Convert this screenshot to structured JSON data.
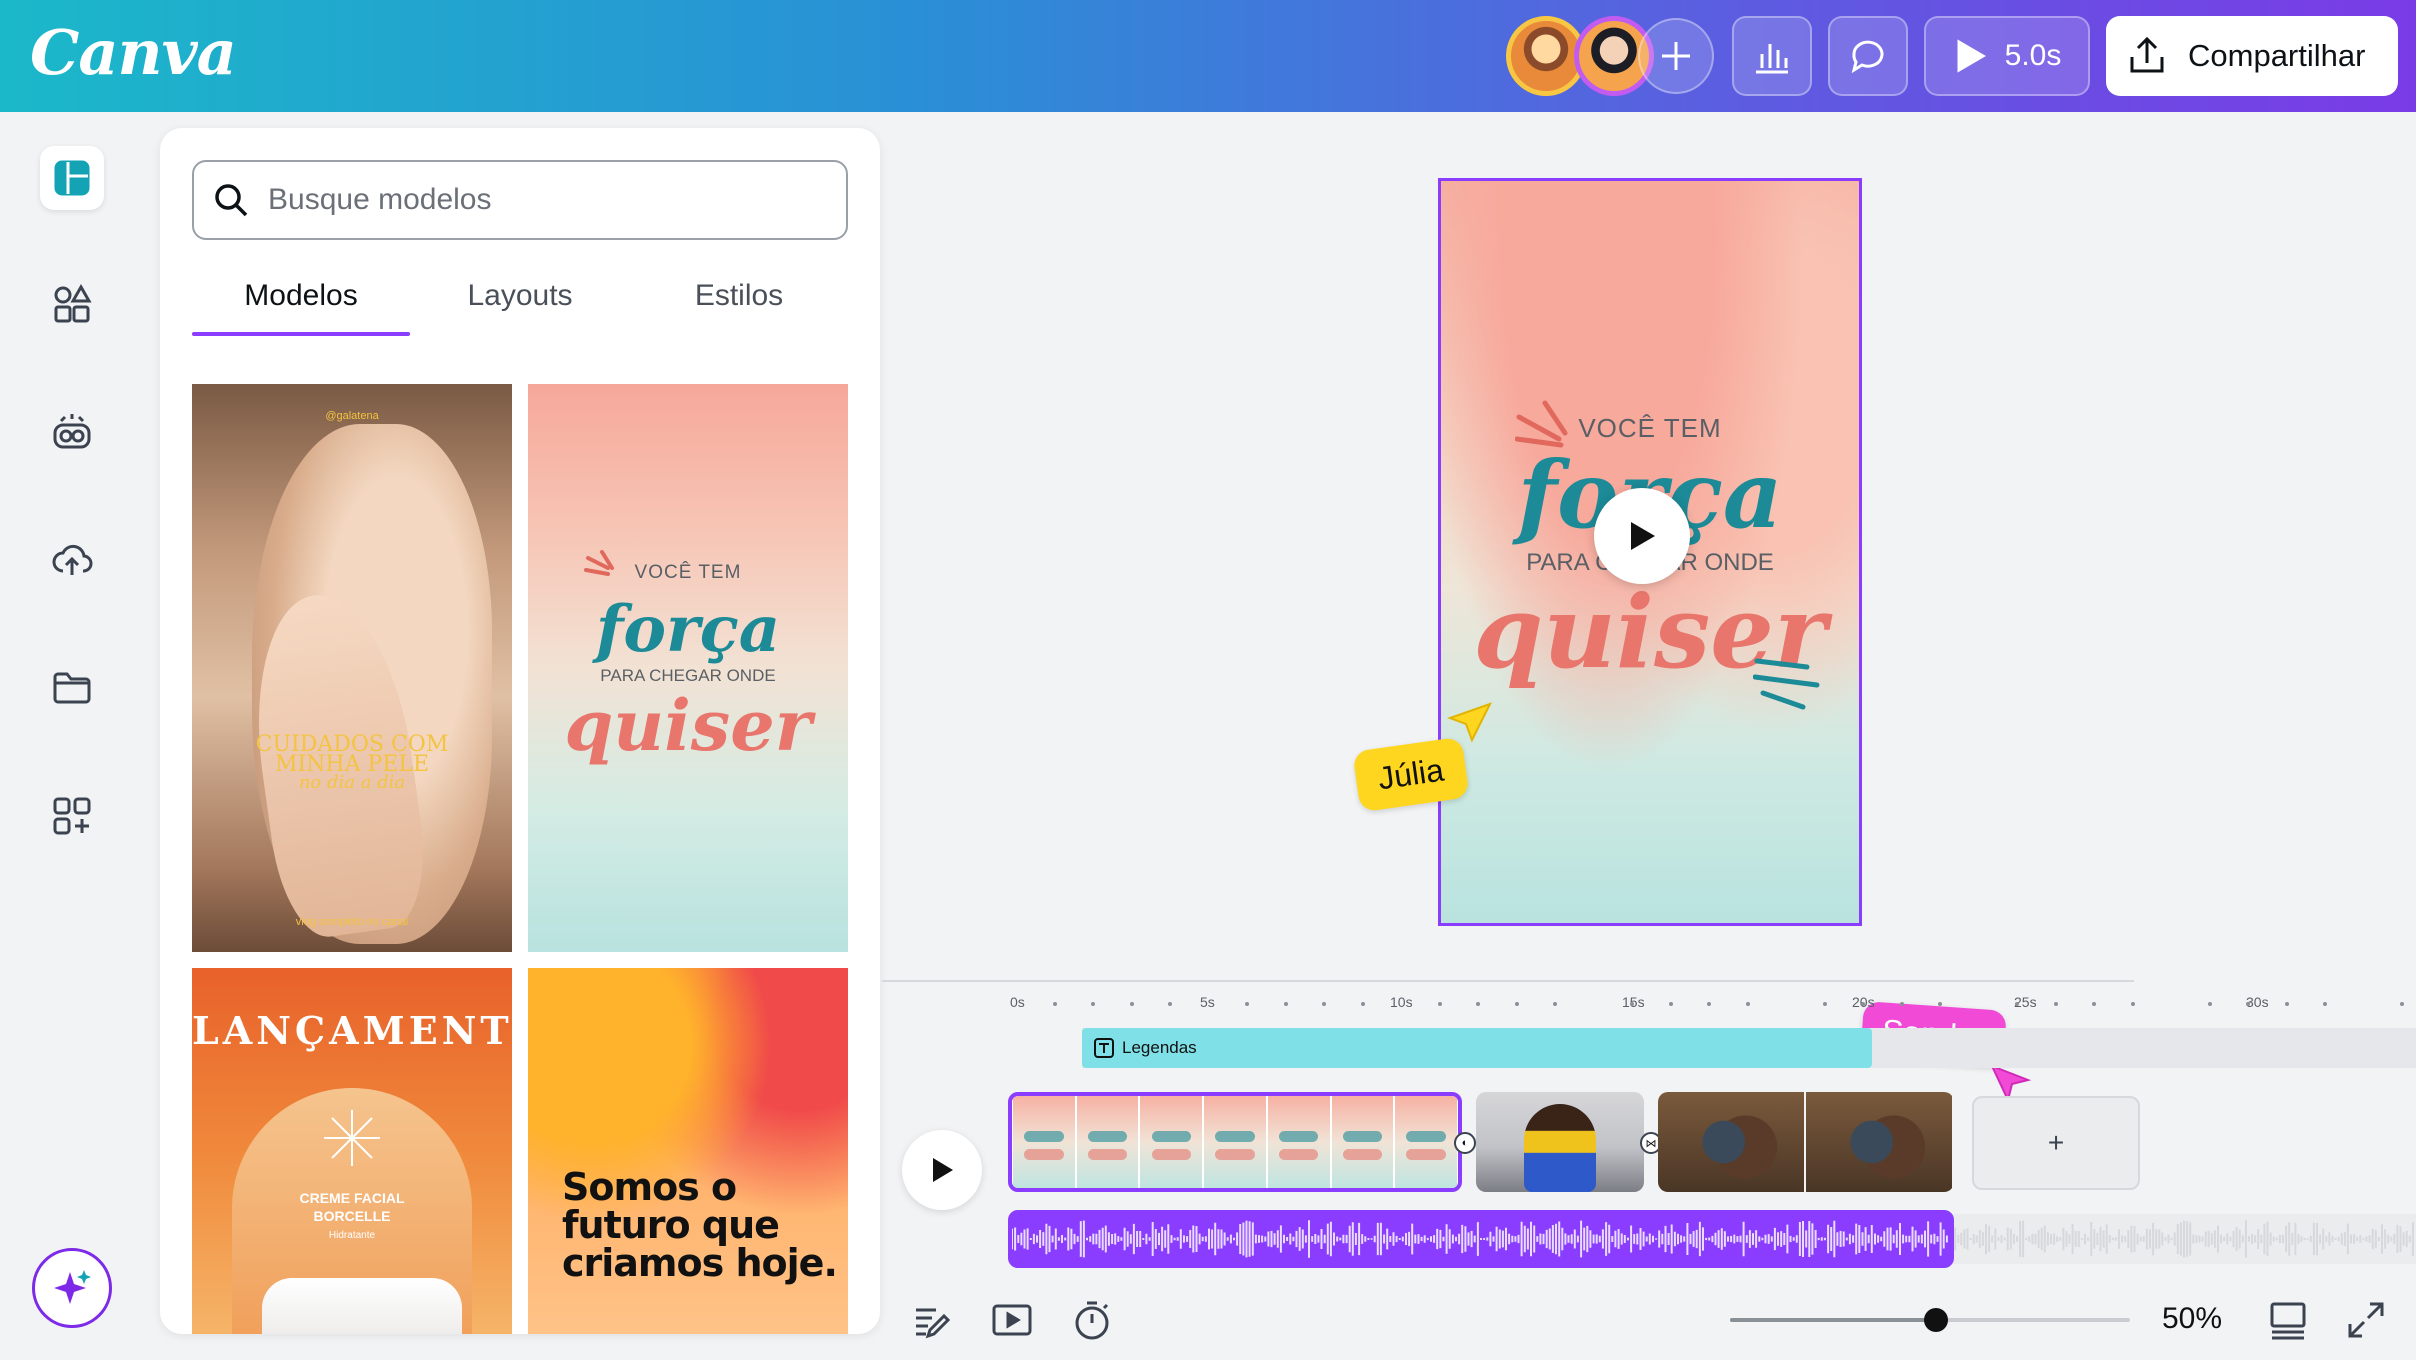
{
  "header": {
    "logo": "Canva",
    "play_duration": "5.0s",
    "share_label": "Compartilhar",
    "gradient": [
      "#1bb8c9",
      "#2a8fd6",
      "#7a3be6"
    ]
  },
  "rail": {
    "items": [
      {
        "icon": "design-icon",
        "active": true
      },
      {
        "icon": "elements-icon"
      },
      {
        "icon": "brand-icon"
      },
      {
        "icon": "upload-icon"
      },
      {
        "icon": "folder-icon"
      },
      {
        "icon": "apps-icon"
      }
    ],
    "magic_icon": "sparkle-icon"
  },
  "panel": {
    "search_placeholder": "Busque modelos",
    "tabs": [
      {
        "label": "Modelos",
        "active": true
      },
      {
        "label": "Layouts"
      },
      {
        "label": "Estilos"
      }
    ],
    "thumbs": {
      "t1": {
        "handle": "@galatena",
        "line1": "CUIDADOS COM",
        "line2": "MINHA PELE",
        "line3": "no dia a dia",
        "footer": "vlog completo no canal"
      },
      "t2": {
        "line1": "VOCÊ TEM",
        "line2": "força",
        "line3": "PARA CHEGAR ONDE",
        "line4": "quiser"
      },
      "t3": {
        "title": "LANÇAMENTO",
        "product1": "CREME FACIAL",
        "product2": "BORCELLE",
        "product3": "Hidratante"
      },
      "t4": {
        "text": "Somos o futuro que criamos hoje."
      }
    }
  },
  "canvas": {
    "line1": "VOCÊ TEM",
    "line2": "força",
    "line3": "PARA CHEGAR ONDE",
    "line4": "quiser",
    "selection_color": "#8b3dff"
  },
  "collaborators": {
    "julia": "Júlia",
    "sandro": "Sandro"
  },
  "timeline": {
    "ruler": [
      "0s",
      "5s",
      "10s",
      "15s",
      "20s",
      "25s",
      "30s"
    ],
    "captions_track": "Legendas",
    "add_label": "+"
  },
  "footer": {
    "zoom": "50%",
    "zoom_value": 0.5
  }
}
